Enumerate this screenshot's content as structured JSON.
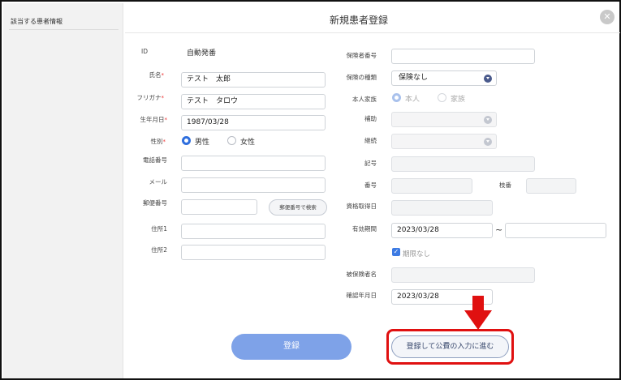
{
  "sidebar": {
    "title": "該当する患者情報"
  },
  "dialog": {
    "title": "新規患者登録",
    "close_glyph": "✕"
  },
  "left": {
    "id": {
      "label": "ID",
      "value": "自動発番"
    },
    "name": {
      "label": "氏名",
      "required": "*",
      "value": "テスト　太郎"
    },
    "furigana": {
      "label": "フリガナ",
      "required": "*",
      "value": "テスト　タロウ"
    },
    "birth": {
      "label": "生年月日",
      "required": "*",
      "value": "1987/03/28"
    },
    "sex": {
      "label": "性別",
      "required": "*",
      "male": "男性",
      "female": "女性",
      "selected": "male"
    },
    "phone": {
      "label": "電話番号",
      "value": ""
    },
    "mail": {
      "label": "メール",
      "value": ""
    },
    "postal": {
      "label": "郵便番号",
      "value": "",
      "search_button": "郵便番号で検索"
    },
    "address1": {
      "label": "住所1",
      "value": ""
    },
    "address2": {
      "label": "住所2",
      "value": ""
    }
  },
  "right": {
    "insurer_no": {
      "label": "保険者番号",
      "value": ""
    },
    "insurance_type": {
      "label": "保険の種類",
      "value": "保険なし"
    },
    "family": {
      "label": "本人家族",
      "self": "本人",
      "family": "家族",
      "selected": "self"
    },
    "subsidy": {
      "label": "補助",
      "value": ""
    },
    "continuation": {
      "label": "継続",
      "value": ""
    },
    "symbol": {
      "label": "記号",
      "value": ""
    },
    "number": {
      "label": "番号",
      "value": "",
      "branch_label": "枝番",
      "branch_value": ""
    },
    "acquired": {
      "label": "資格取得日",
      "value": ""
    },
    "valid": {
      "label": "有効期間",
      "from": "2023/03/28",
      "tilde": "~",
      "to": ""
    },
    "no_limit": {
      "label": "期限なし",
      "checked": true
    },
    "insured_name": {
      "label": "被保険者名",
      "value": ""
    },
    "confirmed": {
      "label": "確認年月日",
      "value": "2023/03/28"
    }
  },
  "actions": {
    "register": "登録",
    "register_next": "登録して公費の入力に進む"
  },
  "colors": {
    "accent": "#2f6fde",
    "primary_button": "#7ea2e8",
    "highlight": "#e01010"
  }
}
